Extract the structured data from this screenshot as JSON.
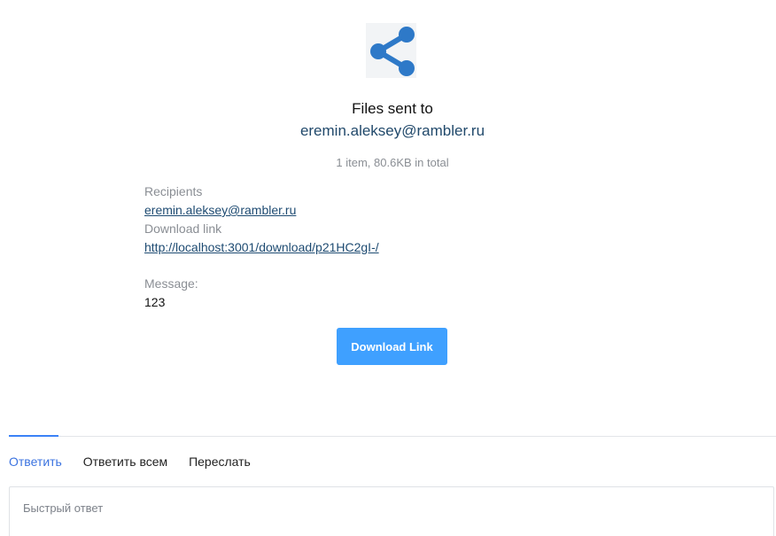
{
  "header": {
    "logo_icon": "share-icon",
    "title": "Files sent to",
    "recipient": "eremin.aleksey@rambler.ru",
    "summary": "1 item, 80.6KB in total"
  },
  "details": {
    "recipients_label": "Recipients",
    "recipient_link": "eremin.aleksey@rambler.ru",
    "download_label": "Download link",
    "download_url": "http://localhost:3001/download/p21HC2gI-/",
    "message_label": "Message:",
    "message_value": "123"
  },
  "download_button": {
    "label": "Download Link"
  },
  "reply_tabs": [
    {
      "label": "Ответить",
      "active": true
    },
    {
      "label": "Ответить всем",
      "active": false
    },
    {
      "label": "Переслать",
      "active": false
    }
  ],
  "quick_reply": {
    "placeholder": "Быстрый ответ"
  },
  "colors": {
    "logo": "#2e79c8",
    "button": "#3fa0ff",
    "active_tab": "#3b73e0"
  }
}
